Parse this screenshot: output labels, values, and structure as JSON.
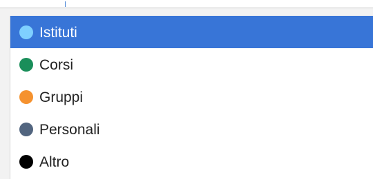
{
  "menu": {
    "selected_index": 0,
    "options": [
      {
        "label": "Istituti",
        "icon": "light-blue-dot-icon",
        "color": "#7fd0ff"
      },
      {
        "label": "Corsi",
        "icon": "green-dot-icon",
        "color": "#1a8e5a"
      },
      {
        "label": "Gruppi",
        "icon": "orange-dot-icon",
        "color": "#f5922f"
      },
      {
        "label": "Personali",
        "icon": "slate-dot-icon",
        "color": "#52657f"
      },
      {
        "label": "Altro",
        "icon": "black-dot-icon",
        "color": "#000000"
      }
    ]
  }
}
